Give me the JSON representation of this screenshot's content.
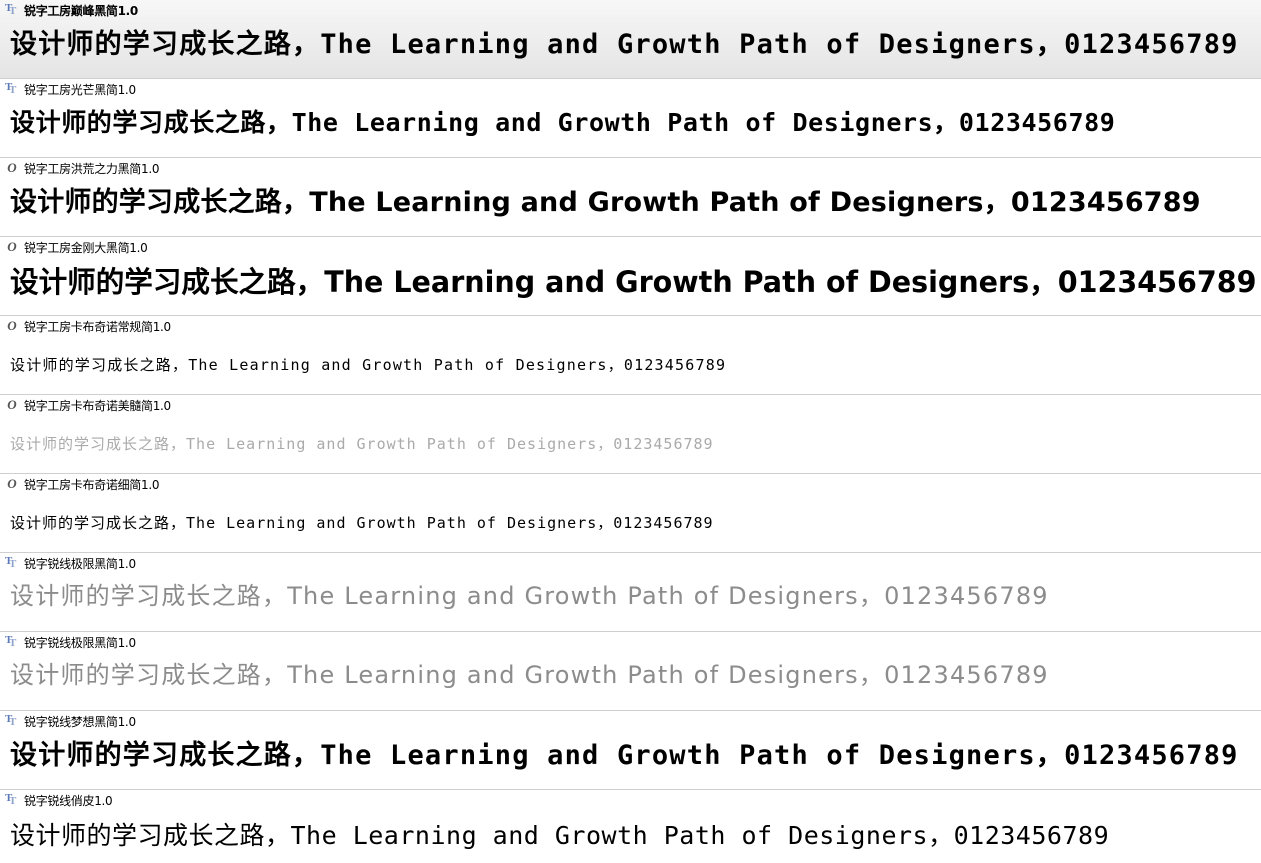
{
  "sample_text": "设计师的学习成长之路，The Learning and Growth Path of Designers，0123456789",
  "fonts": [
    {
      "name": "锐字工房巅峰黑简1.0",
      "icon": "truetype-icon",
      "selected": true
    },
    {
      "name": "锐字工房光芒黑简1.0",
      "icon": "truetype-icon",
      "selected": false
    },
    {
      "name": "锐字工房洪荒之力黑简1.0",
      "icon": "opentype-icon",
      "selected": false
    },
    {
      "name": "锐字工房金刚大黑简1.0",
      "icon": "opentype-icon",
      "selected": false
    },
    {
      "name": "锐字工房卡布奇诺常规简1.0",
      "icon": "opentype-icon",
      "selected": false
    },
    {
      "name": "锐字工房卡布奇诺美髓简1.0",
      "icon": "opentype-icon",
      "selected": false
    },
    {
      "name": "锐字工房卡布奇诺细简1.0",
      "icon": "opentype-icon",
      "selected": false
    },
    {
      "name": "锐字锐线极限黑简1.0",
      "icon": "truetype-icon",
      "selected": false
    },
    {
      "name": "锐字锐线极限黑简1.0",
      "icon": "truetype-icon",
      "selected": false
    },
    {
      "name": "锐字锐线梦想黑简1.0",
      "icon": "truetype-icon",
      "selected": false
    },
    {
      "name": "锐字锐线俏皮1.0",
      "icon": "truetype-icon",
      "selected": false
    }
  ],
  "icon_glyphs": {
    "truetype": [
      "T",
      "T"
    ],
    "opentype": "O"
  },
  "colors": {
    "selected_row_top": "#f7f7f7",
    "selected_row_bottom": "#e4e4e4",
    "separator": "#cfcfcf",
    "truetype_icon": "#5b79b8",
    "light_sample": "#8c8c8c"
  }
}
